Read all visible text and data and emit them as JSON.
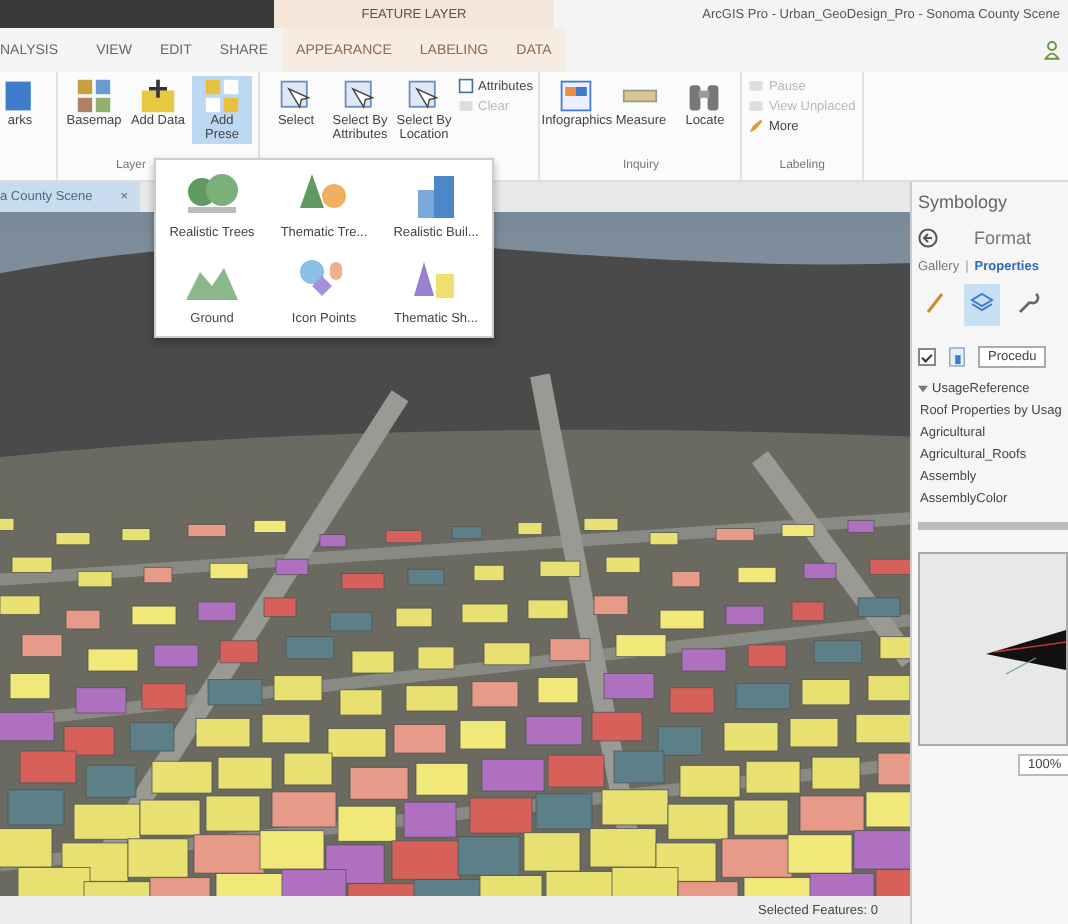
{
  "window": {
    "title": "ArcGIS Pro - Urban_GeoDesign_Pro - Sonoma County Scene",
    "contextual_header": "FEATURE LAYER"
  },
  "ribbon_tabs": [
    {
      "label": "NALYSIS",
      "selected": false,
      "contextual": false
    },
    {
      "label": "VIEW",
      "selected": false,
      "contextual": false
    },
    {
      "label": "EDIT",
      "selected": false,
      "contextual": false
    },
    {
      "label": "SHARE",
      "selected": false,
      "contextual": false
    },
    {
      "label": "APPEARANCE",
      "selected": false,
      "contextual": true
    },
    {
      "label": "LABELING",
      "selected": false,
      "contextual": true
    },
    {
      "label": "DATA",
      "selected": false,
      "contextual": true
    }
  ],
  "ribbon_groups": [
    {
      "buttons": [
        {
          "label": "arks",
          "kind": "large",
          "selected": false
        }
      ]
    },
    {
      "label": "Layer",
      "buttons": [
        {
          "label": "Basemap",
          "kind": "large",
          "selected": false
        },
        {
          "label": "Add Data",
          "kind": "large",
          "selected": false
        },
        {
          "label": "Add Prese",
          "kind": "large",
          "selected": true
        }
      ]
    },
    {
      "buttons": [
        {
          "label": "Select",
          "kind": "large",
          "selected": false
        },
        {
          "label": "Select By Attributes",
          "kind": "large",
          "selected": false
        },
        {
          "label": "Select By Location",
          "kind": "large",
          "selected": false
        },
        {
          "label": "Attributes",
          "kind": "small",
          "disabled": false
        },
        {
          "label": "Clear",
          "kind": "small",
          "disabled": true
        }
      ]
    },
    {
      "label": "Inquiry",
      "buttons": [
        {
          "label": "Infographics",
          "kind": "large",
          "selected": false
        },
        {
          "label": "Measure",
          "kind": "large",
          "selected": false
        },
        {
          "label": "Locate",
          "kind": "large",
          "selected": false
        }
      ]
    },
    {
      "label": "Labeling",
      "buttons": [
        {
          "label": "Pause",
          "kind": "small",
          "disabled": true
        },
        {
          "label": "View Unplaced",
          "kind": "small",
          "disabled": true
        },
        {
          "label": "More",
          "kind": "small",
          "disabled": false
        }
      ]
    }
  ],
  "preset_gallery": [
    {
      "label": "Realistic Trees"
    },
    {
      "label": "Thematic Tre..."
    },
    {
      "label": "Realistic Buil..."
    },
    {
      "label": "Ground"
    },
    {
      "label": "Icon Points"
    },
    {
      "label": "Thematic Sh..."
    }
  ],
  "view_tab": {
    "label": "a County Scene",
    "close": "×"
  },
  "status_bar": {
    "text": "Selected Features: 0"
  },
  "symbology": {
    "title": "Symbology",
    "heading": "Format",
    "subtabs": [
      {
        "label": "Gallery",
        "selected": false
      },
      {
        "label": "Properties",
        "selected": true
      }
    ],
    "subtab_separator": "|",
    "tool_tabs": [
      {
        "kind": "brush",
        "selected": false
      },
      {
        "kind": "layers",
        "selected": true
      },
      {
        "kind": "wrench",
        "selected": false
      }
    ],
    "checked": true,
    "dropdown": "Procedu",
    "tree": [
      {
        "label": "UsageReference",
        "expanded": true,
        "children": [
          {
            "label": "Roof Properties by Usag"
          },
          {
            "label": "Agricultural"
          },
          {
            "label": "Agricultural_Roofs"
          },
          {
            "label": "Assembly"
          },
          {
            "label": "AssemblyColor"
          }
        ]
      }
    ],
    "zoom": "100%"
  }
}
